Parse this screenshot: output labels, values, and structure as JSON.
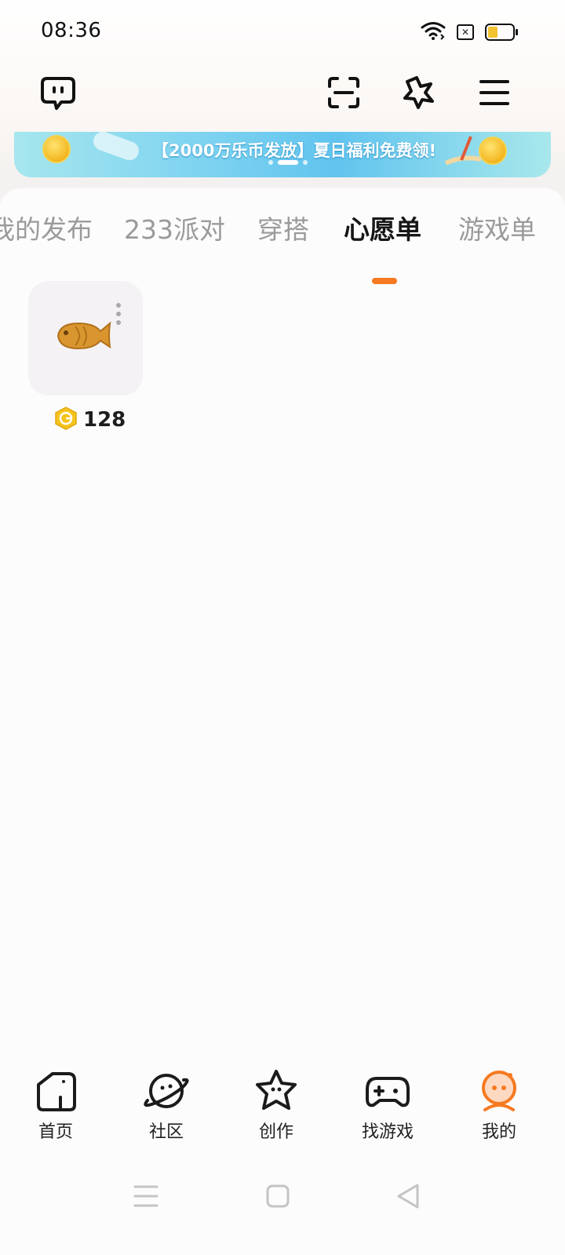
{
  "status_bar": {
    "time": "08:36",
    "icons": [
      "wifi-icon",
      "sim-icon",
      "battery-icon"
    ],
    "battery_color": "#f2c230"
  },
  "topnav": {
    "icons": [
      "chat-bubble-icon",
      "scan-icon",
      "sparkle-star-icon",
      "menu-icon"
    ]
  },
  "banner": {
    "text": "【2000万乐币发放】夏日福利免费领!",
    "colors": [
      "#a6e6ee",
      "#61c4ee"
    ]
  },
  "tabs": {
    "items": [
      {
        "label": "我的发布"
      },
      {
        "label": "233派对"
      },
      {
        "label": "穿搭"
      },
      {
        "label": "心愿单"
      },
      {
        "label": "游戏单"
      }
    ],
    "active_index": 3,
    "accent": "#f57a21"
  },
  "wishlist": {
    "items": [
      {
        "icon": "taiyaki-fish-icon",
        "price": "128",
        "currency_icon": "g-coin-icon"
      }
    ]
  },
  "bottom_nav": {
    "items": [
      {
        "label": "首页",
        "icon": "home-icon"
      },
      {
        "label": "社区",
        "icon": "planet-icon"
      },
      {
        "label": "创作",
        "icon": "star-face-icon"
      },
      {
        "label": "找游戏",
        "icon": "gamepad-icon"
      },
      {
        "label": "我的",
        "icon": "profile-face-icon"
      }
    ],
    "active_index": 4,
    "active_color": "#f57a21"
  },
  "system_nav": {
    "icons": [
      "recents-icon",
      "home-square-icon",
      "back-triangle-icon"
    ]
  }
}
